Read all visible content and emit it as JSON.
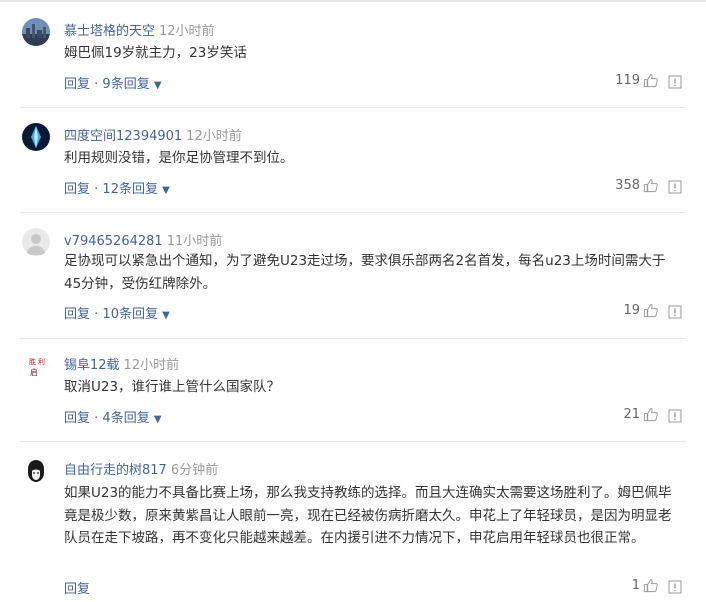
{
  "comments": [
    {
      "username": "慕士塔格的天空",
      "time": "12小时前",
      "text": "姆巴佩19岁就主力，23岁笑话",
      "reply_label": "回复",
      "replies_label": "9条回复",
      "likes": "119",
      "avatar_icon": "city-skyline-avatar"
    },
    {
      "username": "四度空间12394901",
      "time": "12小时前",
      "text": "利用规则没错，是你足协管理不到位。",
      "reply_label": "回复",
      "replies_label": "12条回复",
      "likes": "358",
      "avatar_icon": "blue-crystal-avatar"
    },
    {
      "username": "v79465264281",
      "time": "11小时前",
      "text": "足协现可以紧急出个通知，为了避免U23走过场，要求俱乐部两名2名首发，每名u23上场时间需大于45分钟，受伤红牌除外。",
      "reply_label": "回复",
      "replies_label": "10条回复",
      "likes": "19",
      "avatar_icon": "default-user-avatar"
    },
    {
      "username": "锡阜12载",
      "time": "12小时前",
      "text": "取消U23，谁行谁上管什么国家队？",
      "reply_label": "回复",
      "replies_label": "4条回复",
      "likes": "21",
      "avatar_icon": "calligraphy-avatar"
    },
    {
      "username": "自由行走的树817",
      "time": "6分钟前",
      "text": "如果U23的能力不具备比赛上场，那么我支持教练的选择。而且大连确实太需要这场胜利了。姆巴佩毕竟是极少数，原来黄紫昌让人眼前一亮，现在已经被伤病折磨太久。申花上了年轻球员，是因为明显老队员在走下坡路，再不变化只能越来越差。在内援引进不力情况下，申花启用年轻球员也很正常。",
      "reply_label": "回复",
      "replies_label": "",
      "likes": "1",
      "avatar_icon": "che-portrait-avatar"
    }
  ],
  "colors": {
    "username": "#406599",
    "time": "#999999",
    "text": "#333333",
    "divider": "#e8e8e8"
  }
}
